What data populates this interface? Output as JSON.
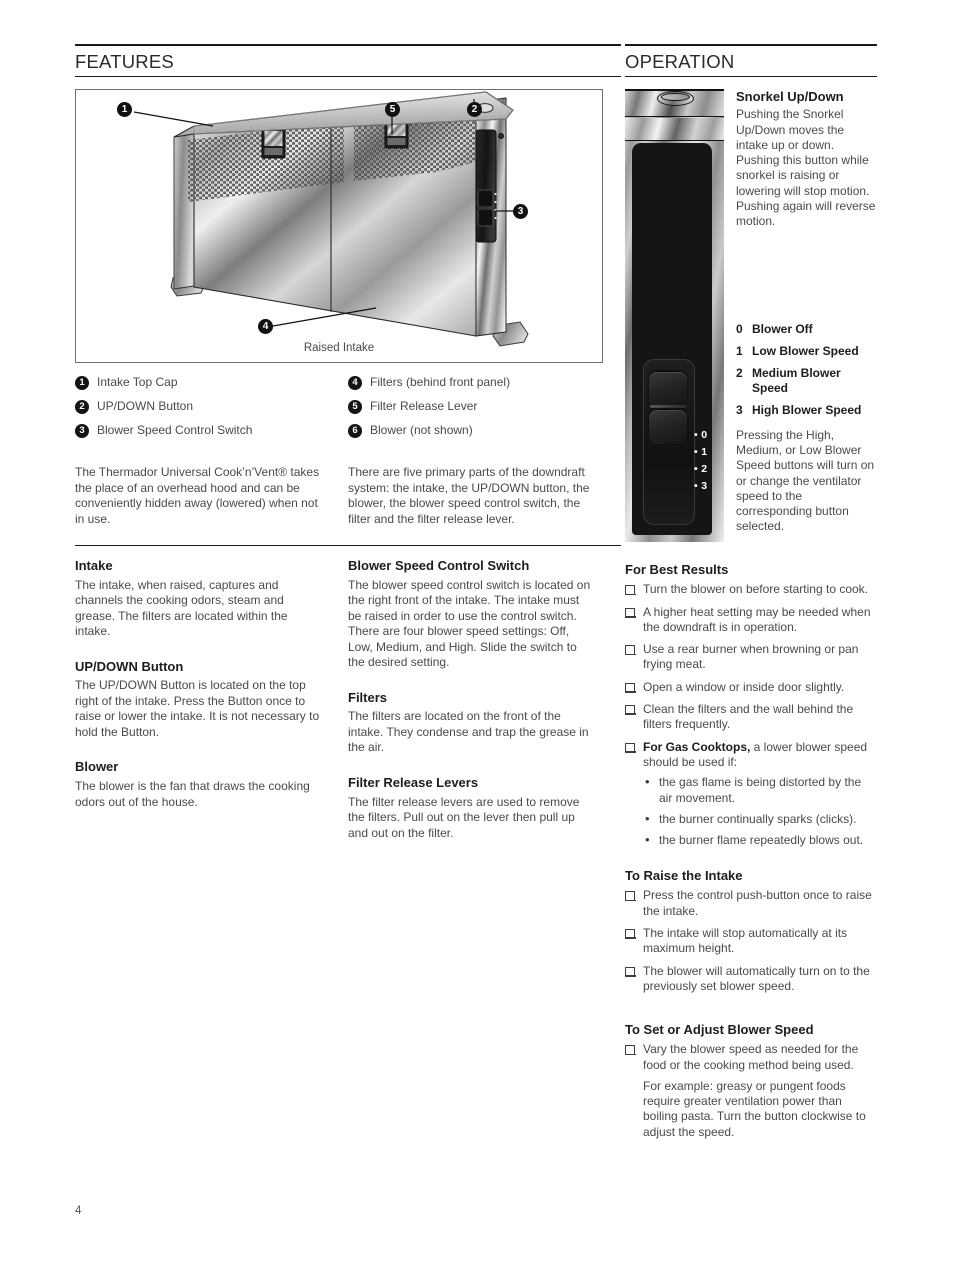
{
  "page_number": "4",
  "features": {
    "heading": "FEATURES",
    "figure": {
      "caption": "Raised Intake",
      "callouts": [
        "1",
        "5",
        "2",
        "3",
        "4"
      ]
    },
    "legend": {
      "left": [
        {
          "num": "1",
          "label": "Intake Top Cap"
        },
        {
          "num": "2",
          "label": "UP/DOWN Button"
        },
        {
          "num": "3",
          "label": "Blower Speed Control Switch"
        }
      ],
      "right": [
        {
          "num": "4",
          "label": "Filters (behind front panel)"
        },
        {
          "num": "5",
          "label": "Filter Release Lever"
        },
        {
          "num": "6",
          "label": "Blower (not shown)"
        }
      ]
    },
    "intro": {
      "left": "The Thermador Universal Cook’n’Vent® takes the place of an overhead hood and can be conveniently hidden away (lowered) when not in use.",
      "right": "There are five primary parts of the downdraft system: the intake, the UP/DOWN button, the blower, the blower speed control switch, the filter and the filter release lever."
    },
    "topics_left": [
      {
        "title": "Intake",
        "body": "The intake, when raised, captures and channels the cooking odors, steam and grease. The filters are located within the intake."
      },
      {
        "title": "UP/DOWN Button",
        "body": "The UP/DOWN Button is located on the top right of the intake. Press the Button once to raise or lower the intake. It is not necessary to hold the Button."
      },
      {
        "title": "Blower",
        "body": "The blower is the fan that draws the cooking odors out of the house."
      }
    ],
    "topics_right": [
      {
        "title": "Blower Speed Control Switch",
        "body": "The blower speed control switch is located on the right front of the intake. The intake must be raised in order to use the control switch. There are four blower speed settings: Off, Low, Medium, and High. Slide the switch to the desired setting."
      },
      {
        "title": "Filters",
        "body": "The filters are located on the front of the intake. They condense and trap the grease in the air."
      },
      {
        "title": "Filter Release Levers",
        "body": "The filter release levers are used to remove the filters. Pull out on the lever then pull up and out on the filter."
      }
    ]
  },
  "operation": {
    "heading": "OPERATION",
    "device": {
      "speed_marks": [
        "• 0",
        "• 1",
        "• 2",
        "• 3"
      ]
    },
    "snorkel": {
      "title": "Snorkel Up/Down",
      "body": "Pushing the Snorkel Up/Down moves the intake up or down. Pushing this button while snorkel is raising or lowering will stop motion.\nPushing again will reverse motion."
    },
    "speed_legend": [
      {
        "num": "0",
        "label": "Blower Off"
      },
      {
        "num": "1",
        "label": "Low Blower Speed"
      },
      {
        "num": "2",
        "label": "Medium Blower Speed"
      },
      {
        "num": "3",
        "label": "High Blower Speed"
      }
    ],
    "speed_note": "Pressing the High, Medium, or Low Blower Speed buttons will turn on or change the ventilator speed to the corresponding button selected.",
    "best_results": {
      "title": "For Best Results",
      "items": [
        "Turn the blower on before starting to cook.",
        "A higher heat setting may be needed when the downdraft is in operation.",
        "Use a rear burner when browning or pan frying meat.",
        "Open a window or inside door slightly.",
        "Clean the filters and the wall behind the filters frequently."
      ],
      "gas_item_strong": "For Gas Cooktops,",
      "gas_item_rest": " a lower blower speed should be used if:",
      "gas_subitems": [
        "the gas flame is being distorted by the air movement.",
        "the burner continually sparks (clicks).",
        "the burner flame repeatedly blows out."
      ]
    },
    "raise_intake": {
      "title": "To Raise the Intake",
      "items": [
        "Press the control push-button once to raise the intake.",
        "The intake will stop automatically at its maximum height.",
        "The blower will automatically turn on to the previously set blower speed."
      ]
    },
    "adjust_speed": {
      "title": "To Set or Adjust Blower Speed",
      "items": [
        "Vary the blower speed as needed for the food or the cooking method being used."
      ],
      "continuation": "For example: greasy or pungent foods require greater ventilation power than boiling pasta. Turn the button clockwise to adjust the speed."
    }
  }
}
